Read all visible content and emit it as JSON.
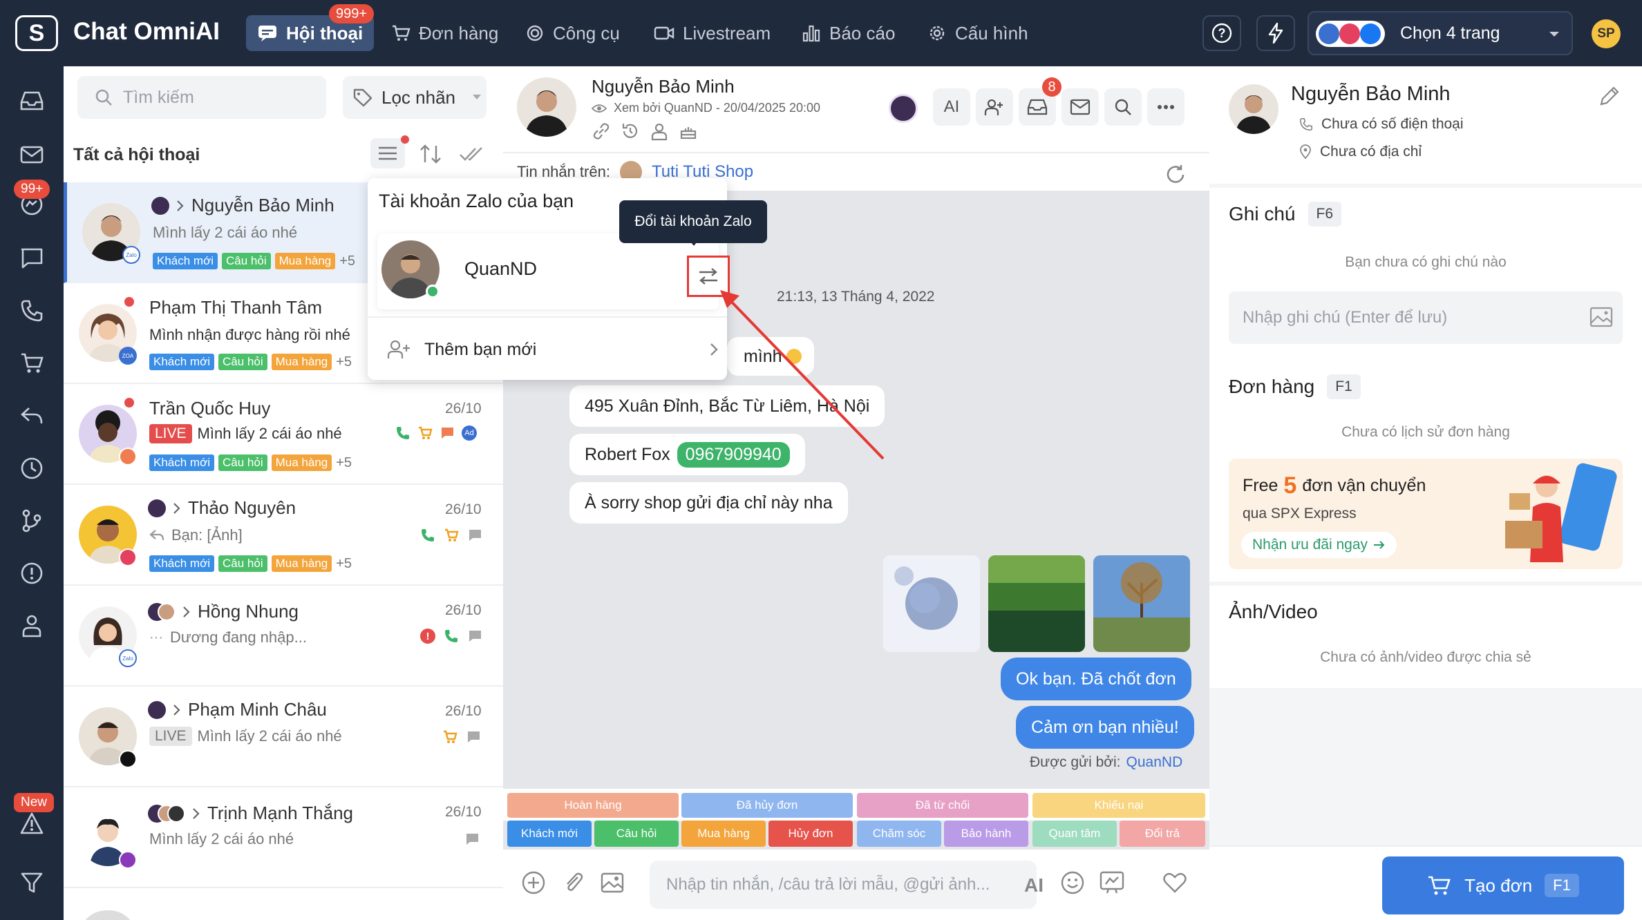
{
  "app": {
    "title": "Chat OmniAI",
    "badge": "999+"
  },
  "nav": [
    {
      "label": "Hội thoại",
      "icon": "chat-icon",
      "active": true
    },
    {
      "label": "Đơn hàng",
      "icon": "cart-icon"
    },
    {
      "label": "Công cụ",
      "icon": "tools-icon"
    },
    {
      "label": "Livestream",
      "icon": "video-icon"
    },
    {
      "label": "Báo cáo",
      "icon": "chart-icon"
    },
    {
      "label": "Cấu hình",
      "icon": "gear-icon"
    }
  ],
  "topbar": {
    "page_select": "Chọn 4 trang",
    "user_initials": "SP"
  },
  "rail": {
    "badge_count": "99+",
    "new_label": "New"
  },
  "search": {
    "placeholder": "Tìm kiếm",
    "filter_label": "Lọc nhãn"
  },
  "list": {
    "header": "Tất cả hội thoại"
  },
  "tags": [
    "Khách mới",
    "Câu hỏi",
    "Mua hàng"
  ],
  "tag_more": "+5",
  "conversations": [
    {
      "name": "Nguyễn Bảo Minh",
      "preview": "Mình lấy 2 cái áo nhé",
      "date": ""
    },
    {
      "name": "Phạm Thị Thanh Tâm",
      "preview": "Mình nhận được hàng rồi nhé",
      "date": ""
    },
    {
      "name": "Trần Quốc Huy",
      "preview": "Mình lấy 2 cái áo nhé",
      "date": "26/10",
      "live": "LIVE"
    },
    {
      "name": "Thảo Nguyên",
      "preview": "Bạn: [Ảnh]",
      "date": "26/10"
    },
    {
      "name": "Hồng Nhung",
      "preview": "Dương đang nhập...",
      "date": "26/10"
    },
    {
      "name": "Phạm Minh Châu",
      "preview": "Mình lấy 2 cái áo nhé",
      "date": "26/10",
      "live": "LIVE"
    },
    {
      "name": "Trịnh Mạnh Thắng",
      "preview": "Mình lấy 2 cái áo nhé",
      "date": "26/10"
    }
  ],
  "popup": {
    "title": "Tài khoản Zalo của bạn",
    "account": "QuanND",
    "add_friend": "Thêm bạn mới",
    "tooltip": "Đổi tài khoản Zalo"
  },
  "chat": {
    "name": "Nguyễn Bảo Minh",
    "seen": "Xem bởi QuanND - 20/04/2025 20:00",
    "ai_label": "AI",
    "inbox_badge": "8",
    "source_prefix": "Tin nhắn trên:",
    "source_shop": "Tuti Tuti Shop",
    "timestamp": "21:13, 13 Tháng 4, 2022",
    "msg_partial": "mình",
    "msg_address": "495 Xuân Đỉnh, Bắc Từ Liêm, Hà Nội",
    "msg_contact_name": "Robert Fox",
    "msg_contact_phone": "0967909940",
    "msg_sorry": "À sorry shop gửi địa chỉ này nha",
    "msg_out1": "Ok bạn. Đã chốt đơn",
    "msg_out2": "Cảm ơn bạn nhiều!",
    "sent_by_label": "Được gửi bởi:",
    "sent_by_user": "QuanND",
    "status_tags": [
      {
        "label": "Hoàn hàng",
        "color": "#f2a98e"
      },
      {
        "label": "Đã hủy đơn",
        "color": "#8fb6ef"
      },
      {
        "label": "Đã từ chối",
        "color": "#e7a0c6"
      },
      {
        "label": "Khiếu nại",
        "color": "#f8d57e"
      }
    ],
    "quick_tags": [
      {
        "label": "Khách mới",
        "color": "#3a8ee6"
      },
      {
        "label": "Câu hỏi",
        "color": "#4cbf6b"
      },
      {
        "label": "Mua hàng",
        "color": "#f3a43b"
      },
      {
        "label": "Hủy đơn",
        "color": "#e5534b"
      },
      {
        "label": "Chăm sóc",
        "color": "#8fb6ef"
      },
      {
        "label": "Bảo hành",
        "color": "#b99be8"
      },
      {
        "label": "Quan tâm",
        "color": "#9edcc0"
      },
      {
        "label": "Đổi trả",
        "color": "#f2a6a6"
      }
    ],
    "composer_placeholder": "Nhập tin nhắn, /câu trả lời mẫu, @gửi ảnh...",
    "composer_ai": "AI"
  },
  "profile": {
    "name": "Nguyễn Bảo Minh",
    "phone": "Chưa có số điện thoại",
    "address": "Chưa có địa chỉ"
  },
  "notes": {
    "title": "Ghi chú",
    "key": "F6",
    "empty": "Bạn chưa có ghi chú nào",
    "placeholder": "Nhập ghi chú (Enter để lưu)"
  },
  "orders": {
    "title": "Đơn hàng",
    "key": "F1",
    "empty": "Chưa có lịch sử đơn hàng"
  },
  "promo": {
    "prefix": "Free",
    "number": "5",
    "suffix": "đơn vận chuyển",
    "sub": "qua SPX Express",
    "cta": "Nhận ưu đãi ngay"
  },
  "media": {
    "title": "Ảnh/Video",
    "empty": "Chưa có ảnh/video được chia sẻ"
  },
  "create_order": {
    "label": "Tạo đơn",
    "key": "F1"
  }
}
